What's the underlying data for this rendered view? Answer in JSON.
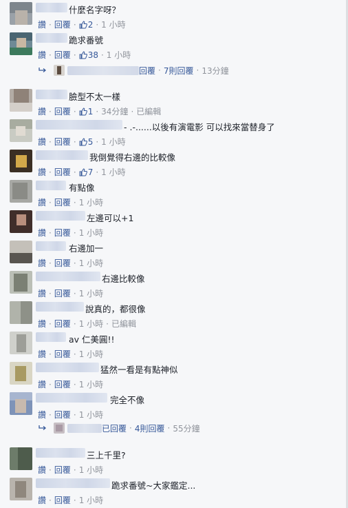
{
  "labels": {
    "like": "讚",
    "reply": "回覆",
    "edited": "已編輯",
    "sep": "·"
  },
  "colors": {
    "link": "#365899",
    "meta": "#90949c",
    "text": "#1d2129",
    "bg": "#f6f7f9"
  },
  "comments": [
    {
      "text": "什麼名字呀？",
      "likes": "2",
      "time": "1 小時",
      "edited": ""
    },
    {
      "text": "跪求番號",
      "likes": "38",
      "time": "1 小時",
      "edited": "",
      "reply_summary": {
        "replied": "回覆",
        "count": "7則回覆",
        "time": "13分鐘"
      }
    },
    {
      "text": "臉型不太一樣",
      "likes": "1",
      "time": "34分鐘",
      "edited": "已編輯"
    },
    {
      "text": "- .-......以後有演電影 可以找來當替身了",
      "likes": "5",
      "time": "1 小時",
      "edited": ""
    },
    {
      "text": "我倒覺得右邊的比較像",
      "likes": "7",
      "time": "1 小時",
      "edited": ""
    },
    {
      "text": "有點像",
      "likes": "",
      "time": "1 小時",
      "edited": ""
    },
    {
      "text": "左邊可以+1",
      "likes": "",
      "time": "1 小時",
      "edited": ""
    },
    {
      "text": "右邊加一",
      "likes": "",
      "time": "1 小時",
      "edited": ""
    },
    {
      "text": "右邊比較像",
      "likes": "",
      "time": "1 小時",
      "edited": ""
    },
    {
      "text": "說真的，都很像",
      "likes": "",
      "time": "1 小時",
      "edited": "已編輯"
    },
    {
      "text": "av 仁美圓!!",
      "likes": "",
      "time": "1 小時",
      "edited": ""
    },
    {
      "text": "猛然一看是有點神似",
      "likes": "",
      "time": "1 小時",
      "edited": ""
    },
    {
      "text": "完全不像",
      "likes": "",
      "time": "1 小時",
      "edited": "",
      "reply_summary": {
        "replied": "已回覆",
        "count": "4則回覆",
        "time": "55分鐘"
      }
    },
    {
      "text": "三上千里?",
      "likes": "",
      "time": "1 小時",
      "edited": ""
    },
    {
      "text": "跪求番號~大家鑑定...",
      "likes": "",
      "time": "1 小時",
      "edited": ""
    }
  ]
}
